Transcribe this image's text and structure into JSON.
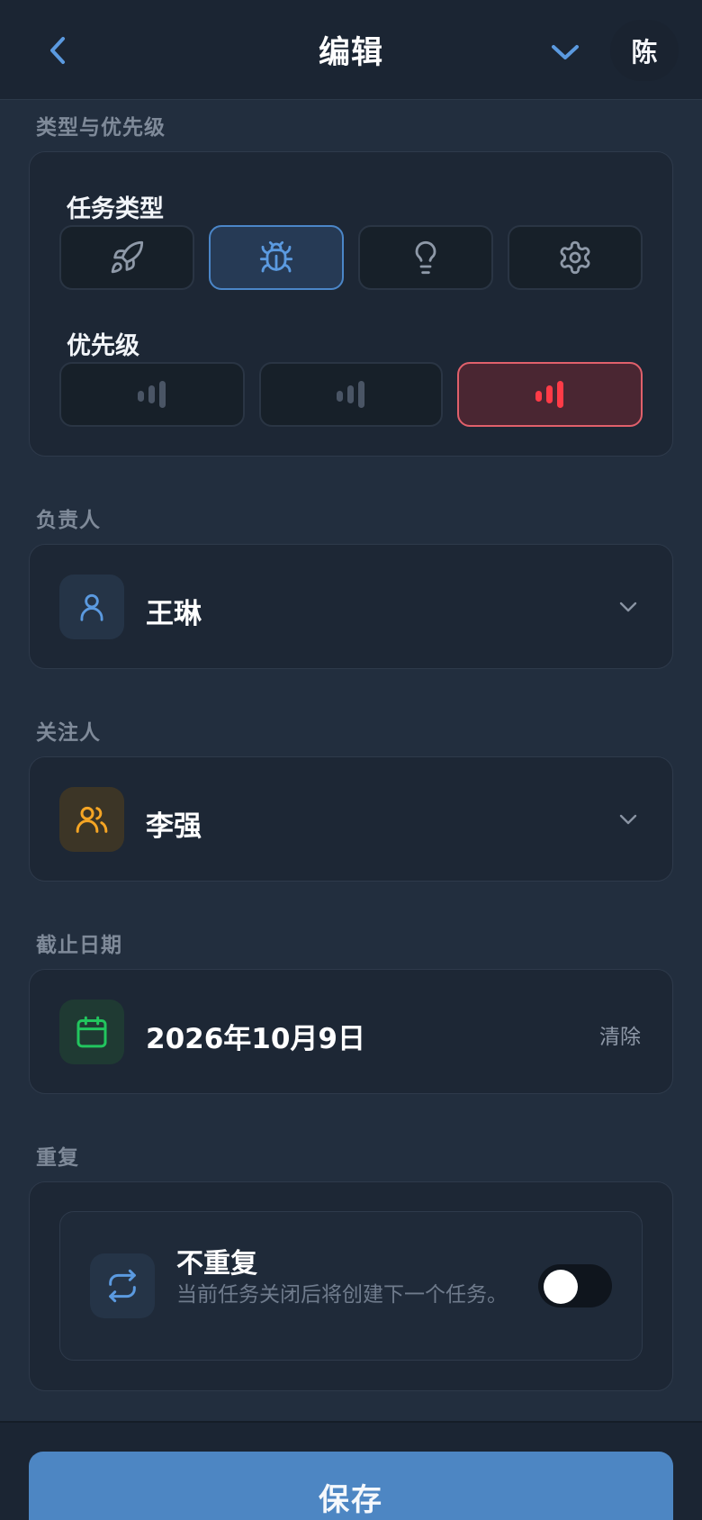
{
  "header": {
    "title": "编辑",
    "avatar_initial": "陈"
  },
  "type_priority": {
    "section_label": "类型与优先级",
    "task_type_label": "任务类型",
    "task_types": [
      {
        "icon": "rocket-icon",
        "selected": false
      },
      {
        "icon": "bug-icon",
        "selected": true
      },
      {
        "icon": "lightbulb-icon",
        "selected": false
      },
      {
        "icon": "gear-icon",
        "selected": false
      }
    ],
    "priority_label": "优先级",
    "priorities": [
      {
        "icon": "signal-low-icon",
        "selected": false
      },
      {
        "icon": "signal-medium-icon",
        "selected": false
      },
      {
        "icon": "signal-high-icon",
        "selected": true
      }
    ]
  },
  "assignee": {
    "section_label": "负责人",
    "value": "王琳"
  },
  "follower": {
    "section_label": "关注人",
    "value": "李强"
  },
  "deadline": {
    "section_label": "截止日期",
    "value": "2026年10月9日",
    "clear_label": "清除"
  },
  "repeat": {
    "section_label": "重复",
    "title": "不重复",
    "description": "当前任务关闭后将创建下一个任务。",
    "enabled": false
  },
  "footer": {
    "save_label": "保存"
  },
  "colors": {
    "accent_blue": "#4d86c3",
    "priority_high": "#ff3b47",
    "deadline_green": "#22c55e",
    "follower_orange": "#f5a524"
  }
}
